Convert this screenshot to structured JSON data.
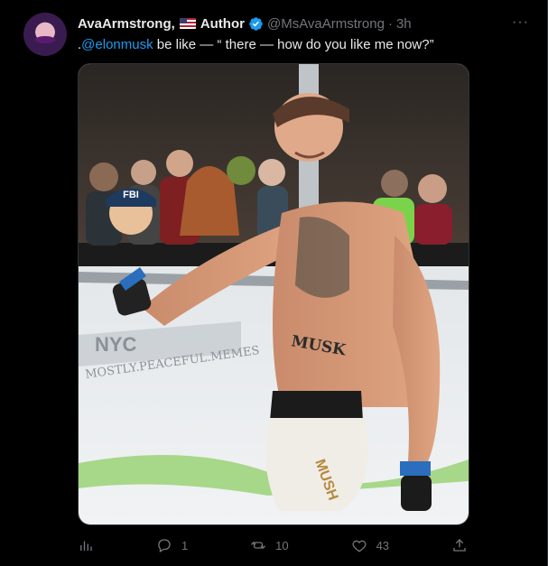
{
  "tweet": {
    "display_name": "AvaArmstrong,",
    "flag_label": "Author",
    "handle": "@MsAvaArmstrong",
    "separator": "·",
    "time": "3h",
    "more_icon": "more-icon",
    "text_prefix": ".",
    "mention": "@elonmusk",
    "text_rest": " be like — “ there — how do you like me now?”",
    "media": {
      "watermark": "MOSTLY.PEACEFUL.MEMES",
      "cap_text": "FBI",
      "chest_text": "MUSK",
      "shorts_text": "MUSH",
      "octagon_text": "NYC"
    },
    "actions": {
      "views_icon": "analytics-icon",
      "reply_icon": "reply-icon",
      "reply_count": "1",
      "retweet_icon": "retweet-icon",
      "retweet_count": "10",
      "like_icon": "heart-icon",
      "like_count": "43",
      "share_icon": "share-icon"
    }
  },
  "colors": {
    "background": "#000000",
    "text": "#e7e9ea",
    "muted": "#71767b",
    "accent": "#1d9bf0"
  }
}
